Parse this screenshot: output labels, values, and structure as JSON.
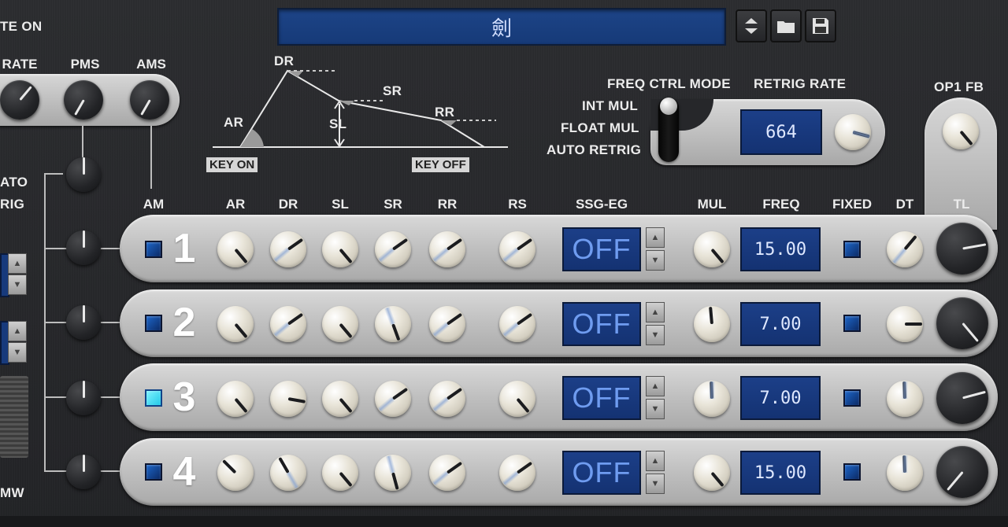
{
  "header": {
    "patch_name": "劍",
    "note_on_label": "TE ON"
  },
  "lfo": {
    "rate_label": "RATE",
    "pms_label": "PMS",
    "ams_label": "AMS",
    "vibrato_label": "ATO",
    "vibrato_sub_label": "RIG",
    "mw_label": "MW"
  },
  "envelope_diagram": {
    "ar": "AR",
    "dr": "DR",
    "sl": "SL",
    "sr": "SR",
    "rr": "RR",
    "key_on": "KEY ON",
    "key_off": "KEY OFF"
  },
  "freq_ctrl": {
    "title": "FREQ CTRL MODE",
    "options": [
      "INT MUL",
      "FLOAT MUL",
      "AUTO RETRIG"
    ],
    "retrig_rate_label": "RETRIG RATE",
    "retrig_rate_value": "664",
    "op1_fb_label": "OP1 FB"
  },
  "columns": {
    "am": "AM",
    "ar": "AR",
    "dr": "DR",
    "sl": "SL",
    "sr": "SR",
    "rr": "RR",
    "rs": "RS",
    "ssg_eg": "SSG-EG",
    "mul": "MUL",
    "freq": "FREQ",
    "fixed": "FIXED",
    "dt": "DT",
    "tl": "TL"
  },
  "operators": [
    {
      "number": "1",
      "ssg": "OFF",
      "freq": "15.00",
      "am_on": false
    },
    {
      "number": "2",
      "ssg": "OFF",
      "freq": "7.00",
      "am_on": false
    },
    {
      "number": "3",
      "ssg": "OFF",
      "freq": "7.00",
      "am_on": true
    },
    {
      "number": "4",
      "ssg": "OFF",
      "freq": "15.00",
      "am_on": false
    }
  ],
  "icons": {
    "up_down": "up-down-arrows-icon",
    "folder": "folder-icon",
    "save": "floppy-disk-icon"
  }
}
